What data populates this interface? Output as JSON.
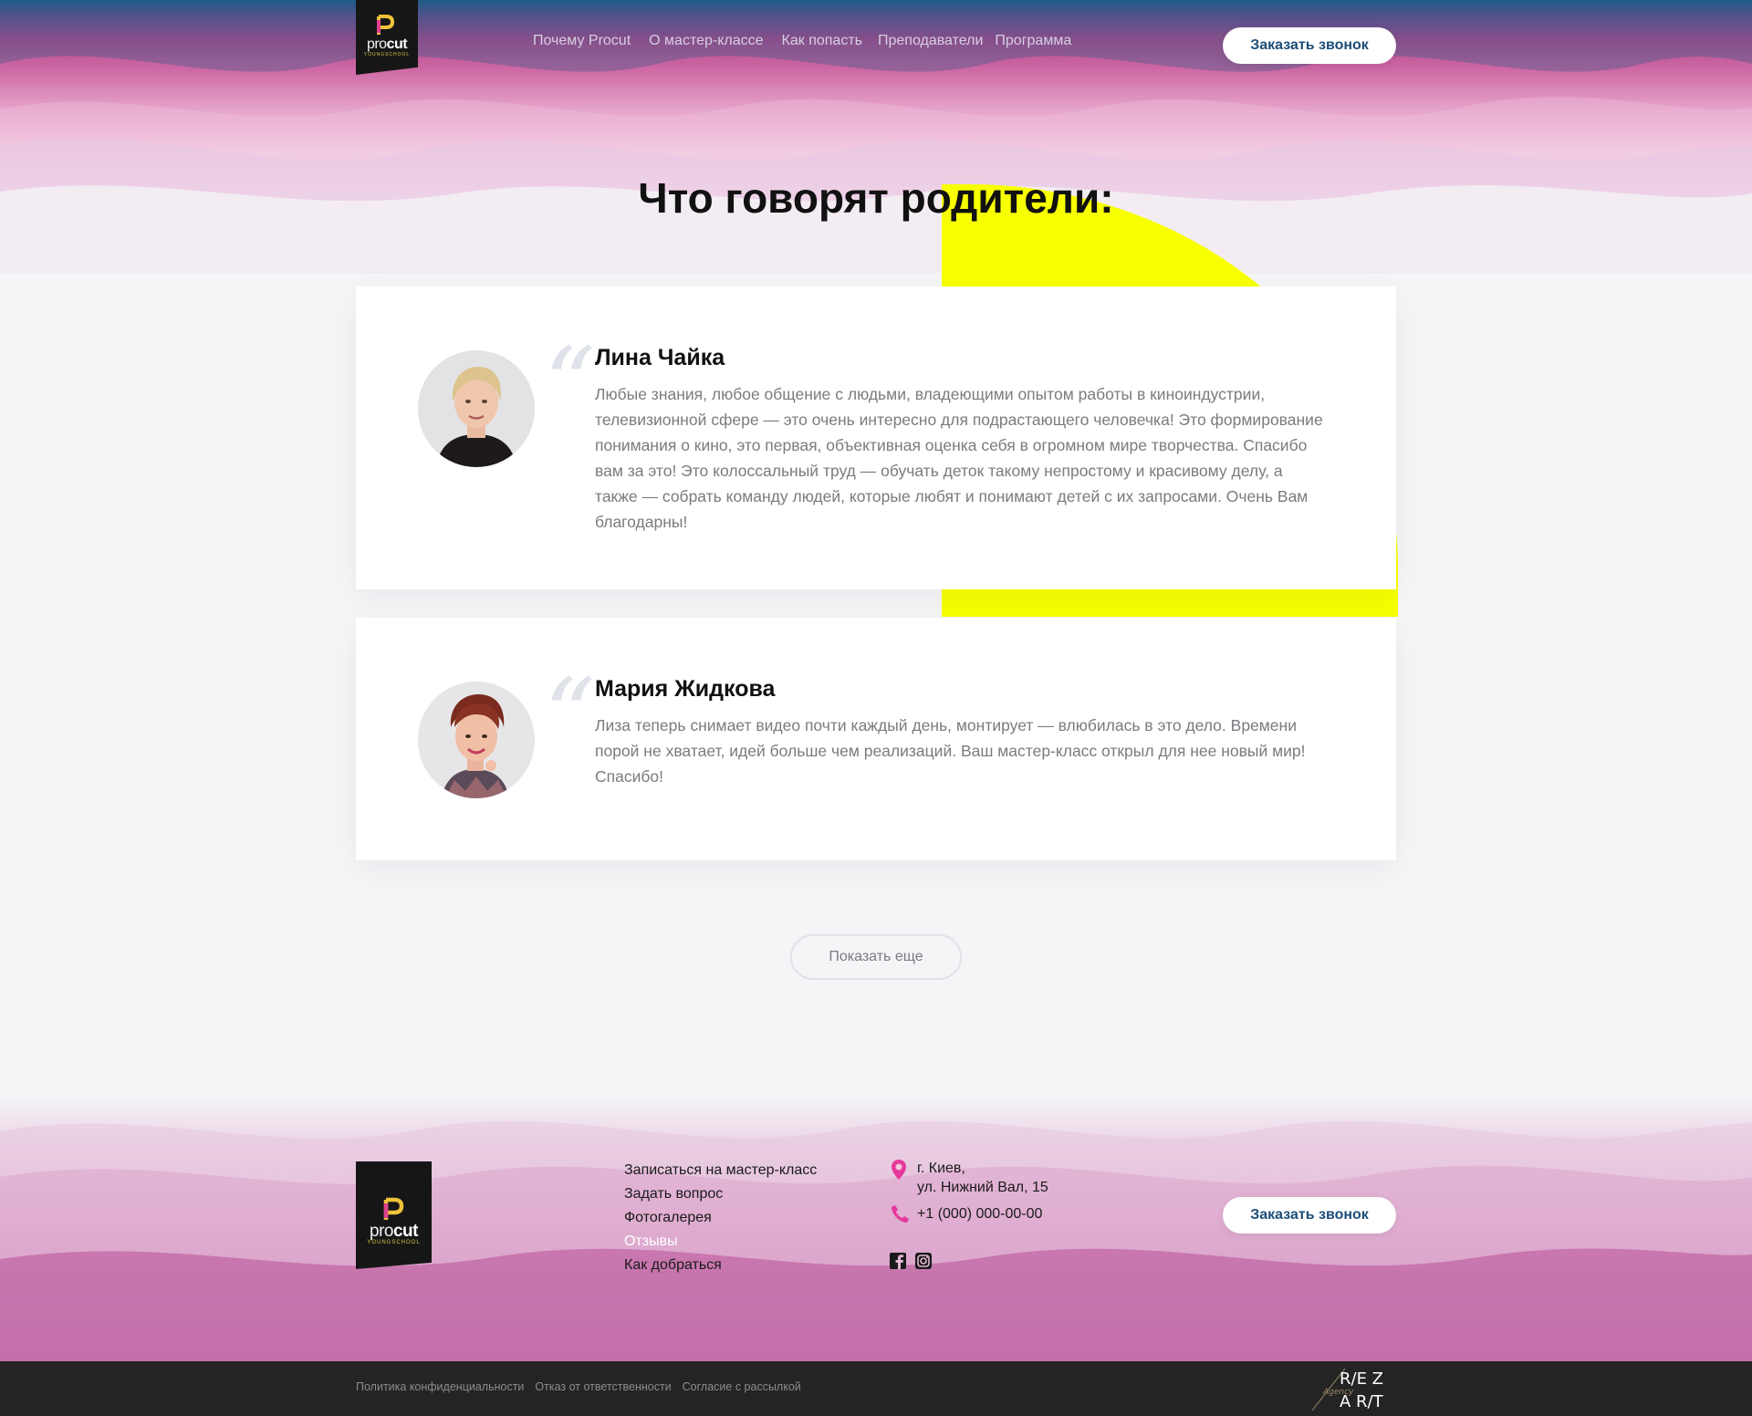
{
  "brand": {
    "logo_pro": "pro",
    "logo_cut": "cut",
    "logo_sub": "YOUNGSCHOOL",
    "accent": "#f7ff00",
    "button_text_color": "#1c4d78"
  },
  "nav": {
    "items": [
      {
        "label": "Почему Procut"
      },
      {
        "label": "О мастер-классе"
      },
      {
        "label": "Как попасть"
      },
      {
        "label": "Преподаватели"
      },
      {
        "label": "Программа"
      }
    ],
    "call_button": "Заказать звонок"
  },
  "section": {
    "title": "Что говорят родители:"
  },
  "reviews": [
    {
      "name": "Лина Чайка",
      "text": "Любые знания, любое общение с людьми, владеющими опытом работы в киноиндустрии, телевизионной сфере — это очень интересно для подрастающего человечка! Это формирование понимания о кино, это первая, объективная оценка себя в огромном мире творчества. Спасибо вам за это! Это колоссальный труд — обучать деток такому непростому и красивому делу, а также — собрать команду людей, которые любят и понимают детей с их запросами. Очень Вам благодарны!"
    },
    {
      "name": "Мария Жидкова",
      "text": "Лиза  теперь снимает видео почти каждый день, монтирует — влюбилась в это дело. Времени порой не хватает, идей больше чем реализаций. Ваш мастер-класс открыл для нее новый мир! Спасибо!"
    }
  ],
  "show_more": "Показать еще",
  "footer": {
    "links": [
      {
        "label": "Записаться на мастер-класс",
        "active": false
      },
      {
        "label": "Задать вопрос",
        "active": false
      },
      {
        "label": "Фотогалерея",
        "active": false
      },
      {
        "label": "Отзывы",
        "active": true
      },
      {
        "label": "Как добраться",
        "active": false
      }
    ],
    "address_line1": "г. Киев,",
    "address_line2": "ул. Нижний Вал, 15",
    "phone": "+1 (000) 000-00-00",
    "call_button": "Заказать звонок",
    "socials": [
      "facebook-icon",
      "instagram-icon"
    ]
  },
  "legal": [
    {
      "label": "Политика конфиденциальности"
    },
    {
      "label": "Отказ от ответственности"
    },
    {
      "label": "Согласие с рассылкой"
    }
  ],
  "agency": {
    "top": "R/E Z",
    "middle": "Agency",
    "bottom": "A R/T"
  }
}
